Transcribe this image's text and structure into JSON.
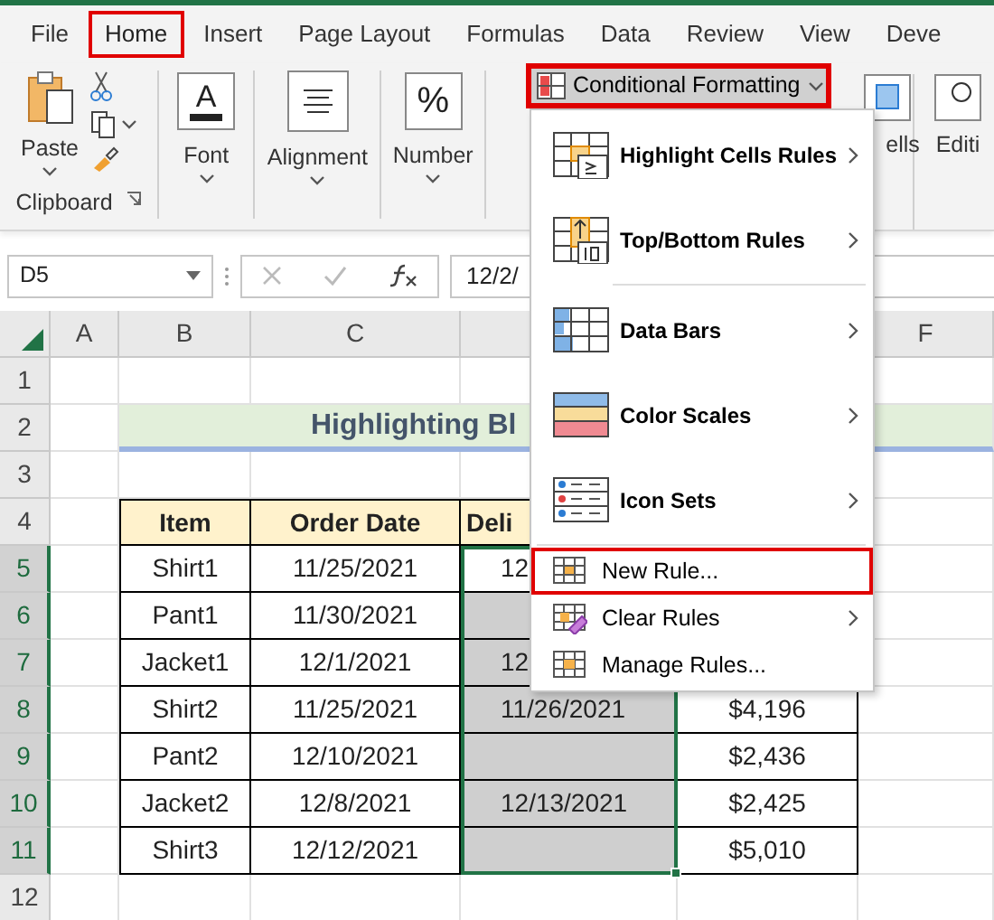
{
  "tabs": [
    {
      "label": "File",
      "annotated": false
    },
    {
      "label": "Home",
      "annotated": true
    },
    {
      "label": "Insert",
      "annotated": false
    },
    {
      "label": "Page Layout",
      "annotated": false
    },
    {
      "label": "Formulas",
      "annotated": false
    },
    {
      "label": "Data",
      "annotated": false
    },
    {
      "label": "Review",
      "annotated": false
    },
    {
      "label": "View",
      "annotated": false
    },
    {
      "label": "Deve",
      "annotated": false
    }
  ],
  "ribbon_groups": [
    {
      "kind": "clipboard",
      "label": "Clipboard",
      "paste_label": "Paste"
    },
    {
      "kind": "glyph",
      "label": "Font",
      "glyph": "A"
    },
    {
      "kind": "align",
      "label": "Alignment"
    },
    {
      "kind": "glyph",
      "label": "Number",
      "glyph": "%"
    }
  ],
  "conditional_formatting": {
    "label": "Conditional Formatting",
    "annotated": true
  },
  "cut_groups": [
    {
      "kind": "cells",
      "label": "ells"
    },
    {
      "kind": "editing",
      "label": "Editi"
    }
  ],
  "formula_bar": {
    "name_box": "D5",
    "formula": "12/2/"
  },
  "column_headers": [
    "A",
    "B",
    "C",
    "F"
  ],
  "row_headers": [
    {
      "number": "1",
      "selected": false
    },
    {
      "number": "2",
      "selected": false
    },
    {
      "number": "3",
      "selected": false
    },
    {
      "number": "4",
      "selected": false
    },
    {
      "number": "5",
      "selected": true
    },
    {
      "number": "6",
      "selected": true
    },
    {
      "number": "7",
      "selected": true
    },
    {
      "number": "8",
      "selected": true
    },
    {
      "number": "9",
      "selected": true
    },
    {
      "number": "10",
      "selected": true
    },
    {
      "number": "11",
      "selected": true
    },
    {
      "number": "12",
      "selected": false
    }
  ],
  "title": "Highlighting Bl",
  "table": {
    "header": [
      "Item",
      "Order Date",
      "Deli"
    ],
    "rows": [
      {
        "item": "Shirt1",
        "order_date": "11/25/2021",
        "column_d": "12",
        "selected": false
      },
      {
        "item": "Pant1",
        "order_date": "11/30/2021",
        "selected": true
      },
      {
        "item": "Jacket1",
        "order_date": "12/1/2021",
        "column_d": "12",
        "selected": true
      },
      {
        "item": "Shirt2",
        "order_date": "11/25/2021",
        "column_d": "11/26/2021",
        "column_e": "$4,196",
        "selected": true
      },
      {
        "item": "Pant2",
        "order_date": "12/10/2021",
        "column_e": "$2,436",
        "selected": true
      },
      {
        "item": "Jacket2",
        "order_date": "12/8/2021",
        "column_d": "12/13/2021",
        "column_e": "$2,425",
        "selected": true
      },
      {
        "item": "Shirt3",
        "order_date": "12/12/2021",
        "column_e": "$5,010",
        "selected": true
      }
    ]
  },
  "menu": [
    {
      "kind": "large",
      "label": "Highlight Cells Rules",
      "submenu": true,
      "separator_before": false,
      "annotated": false
    },
    {
      "kind": "large",
      "label": "Top/Bottom Rules",
      "submenu": true,
      "separator_before": false,
      "annotated": false
    },
    {
      "kind": "large",
      "label": "Data Bars",
      "submenu": true,
      "separator_before": true,
      "annotated": false
    },
    {
      "kind": "large",
      "label": "Color Scales",
      "submenu": true,
      "separator_before": false,
      "annotated": false
    },
    {
      "kind": "large",
      "label": "Icon Sets",
      "submenu": true,
      "separator_before": false,
      "annotated": false
    },
    {
      "kind": "small",
      "label": "New Rule...",
      "submenu": false,
      "separator_before": true,
      "annotated": true
    },
    {
      "kind": "small",
      "label": "Clear Rules",
      "submenu": true,
      "separator_before": false,
      "annotated": false
    },
    {
      "kind": "small",
      "label": "Manage Rules...",
      "submenu": false,
      "separator_before": false,
      "annotated": false
    }
  ]
}
